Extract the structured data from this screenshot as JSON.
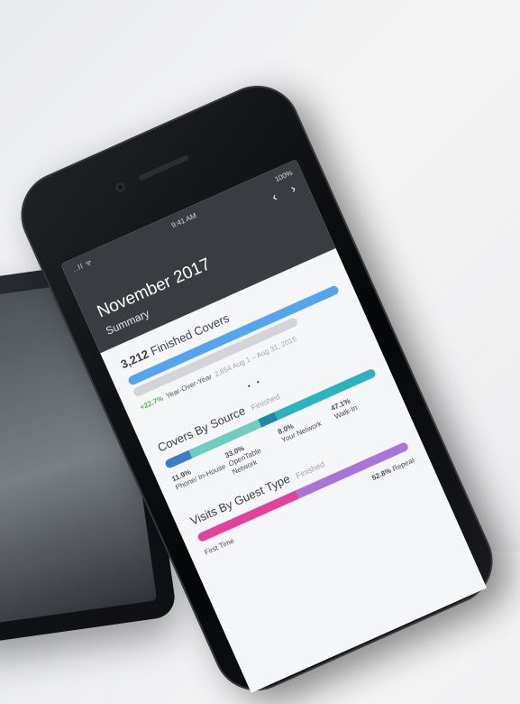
{
  "status_bar": {
    "signal": "..ll ᯤ",
    "time": "9:41 AM",
    "battery": "100%"
  },
  "nav": {
    "prev": "‹",
    "next": "›"
  },
  "header": {
    "month": "November 2017",
    "subtitle": "Summary"
  },
  "covers": {
    "count": "3,212",
    "label": "Finished Covers",
    "yoy_pct": "+22.7%",
    "yoy_label": "Year-Over-Year",
    "compare_range": "2,854 Aug 1 – Aug 31, 2016"
  },
  "pager_dots": "• •",
  "by_source": {
    "title": "Covers By Source",
    "filter": "Finished",
    "segments": [
      {
        "pct": "11.9%",
        "label": "Phone/ In-House",
        "color": "#3a7fc4",
        "share": 0.119
      },
      {
        "pct": "33.0%",
        "label": "OpenTable Network",
        "color": "#6fcdbf",
        "share": 0.33
      },
      {
        "pct": "8.0%",
        "label": "Your Network",
        "color": "#1f86a6",
        "share": 0.08
      },
      {
        "pct": "47.1%",
        "label": "Walk-In",
        "color": "#2bb3c0",
        "share": 0.471
      }
    ]
  },
  "by_guest": {
    "title": "Visits By Guest Type",
    "filter": "Finished",
    "first_label": "First Time",
    "repeat_pct": "52.8%",
    "repeat_label": "Repeat",
    "first_color": "#e2429b",
    "repeat_color": "#a974d9",
    "repeat_share": 0.528
  }
}
